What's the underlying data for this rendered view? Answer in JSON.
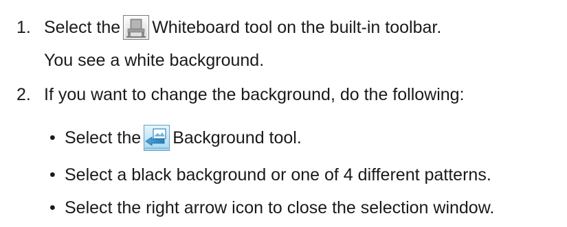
{
  "steps": [
    {
      "number": "1.",
      "line1_before": "Select the",
      "line1_icon": "whiteboard-tool-icon",
      "line1_after": "Whiteboard tool on the built-in toolbar.",
      "line2": "You see a white background."
    },
    {
      "number": "2.",
      "line1": "If you want to change the background, do the following:",
      "bullets": [
        {
          "bullet": "•",
          "before": "Select the",
          "icon": "background-tool-icon",
          "after": "Background tool."
        },
        {
          "bullet": "•",
          "text": "Select a black background or one of 4 different patterns."
        },
        {
          "bullet": "•",
          "text": "Select the right arrow icon to close the selection window."
        }
      ]
    }
  ]
}
